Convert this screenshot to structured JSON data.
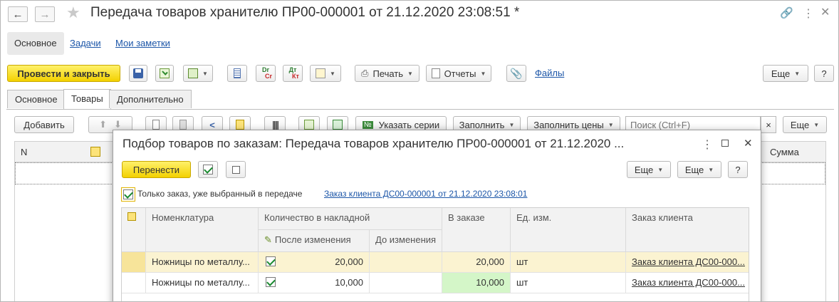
{
  "window": {
    "title": "Передача товаров хранителю ПР00-000001 от 21.12.2020 23:08:51 *"
  },
  "nav_tabs": [
    {
      "label": "Основное"
    },
    {
      "label": "Задачи"
    },
    {
      "label": "Мои заметки"
    }
  ],
  "toolbar": {
    "post_close": "Провести и закрыть",
    "print": "Печать",
    "reports": "Отчеты",
    "files": "Файлы",
    "more": "Еще",
    "help": "?",
    "dt_kt_label_dr": "Dr",
    "dt_kt_label_cr": "Cr",
    "dt_label": "Дт",
    "kt_label": "Кт"
  },
  "form_tabs": [
    {
      "label": "Основное"
    },
    {
      "label": "Товары"
    },
    {
      "label": "Дополнительно"
    }
  ],
  "goods_toolbar": {
    "add": "Добавить",
    "specify_series": "Указать серии",
    "series_icon": "№",
    "fill": "Заполнить",
    "fill_prices": "Заполнить цены",
    "search_placeholder": "Поиск (Ctrl+F)",
    "clear": "×",
    "more": "Еще"
  },
  "goods_table": {
    "col_n": "N",
    "col_sum": "Сумма"
  },
  "modal": {
    "title": "Подбор товаров по заказам: Передача товаров хранителю ПР00-000001 от 21.12.2020 ...",
    "transfer": "Перенести",
    "more1": "Еще",
    "more2": "Еще",
    "help": "?",
    "only_order_label": "Только заказ, уже выбранный в передаче",
    "order_link": "Заказ клиента ДС00-000001 от 21.12.2020 23:08:01",
    "headers": {
      "nomenclature": "Номенклатура",
      "qty_invoice": "Количество в накладной",
      "after_change": "После изменения",
      "before_change": "До изменения",
      "in_order": "В заказе",
      "unit": "Ед. изм.",
      "client_order": "Заказ клиента"
    },
    "rows": [
      {
        "nomenclature": "Ножницы по металлу...",
        "after": "20,000",
        "before": "",
        "in_order": "20,000",
        "unit": "шт",
        "order": "Заказ клиента ДС00-000..."
      },
      {
        "nomenclature": "Ножницы по металлу...",
        "after": "10,000",
        "before": "",
        "in_order": "10,000",
        "unit": "шт",
        "order": "Заказ клиента ДС00-000..."
      }
    ]
  },
  "colors": {
    "accent_yellow": "#f3d100",
    "link": "#1c56a8",
    "highlight_row": "#fbf3d1",
    "green_cell": "#d4f6c8"
  }
}
